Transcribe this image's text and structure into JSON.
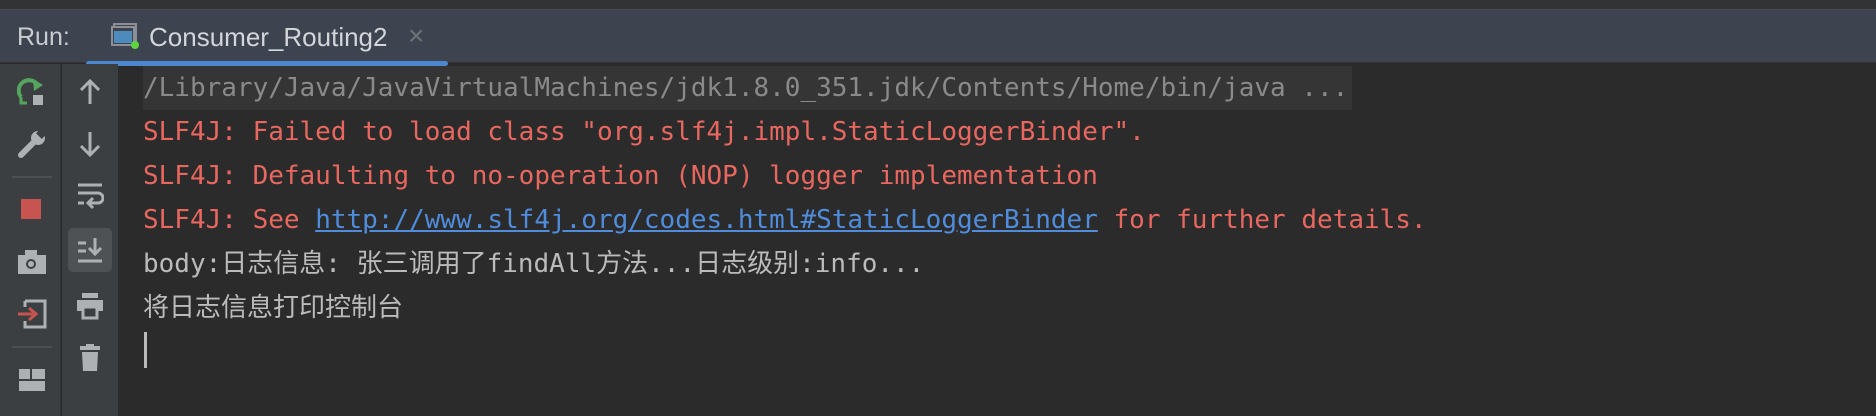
{
  "header": {
    "run_label": "Run:",
    "tab_label": "Consumer_Routing2",
    "close_glyph": "×"
  },
  "console": {
    "lines": [
      {
        "text": "/Library/Java/JavaVirtualMachines/jdk1.8.0_351.jdk/Contents/Home/bin/java ..."
      },
      {
        "text": "SLF4J: Failed to load class \"org.slf4j.impl.StaticLoggerBinder\"."
      },
      {
        "text": "SLF4J: Defaulting to no-operation (NOP) logger implementation"
      },
      {
        "prefix": "SLF4J: See ",
        "link": "http://www.slf4j.org/codes.html#StaticLoggerBinder",
        "suffix": " for further details."
      },
      {
        "text": "body:日志信息: 张三调用了findAll方法...日志级别:info..."
      },
      {
        "text": "将日志信息打印控制台"
      }
    ]
  },
  "colors": {
    "error": "#e8675f",
    "link": "#4f8cdc",
    "accent": "#4c85d0"
  }
}
